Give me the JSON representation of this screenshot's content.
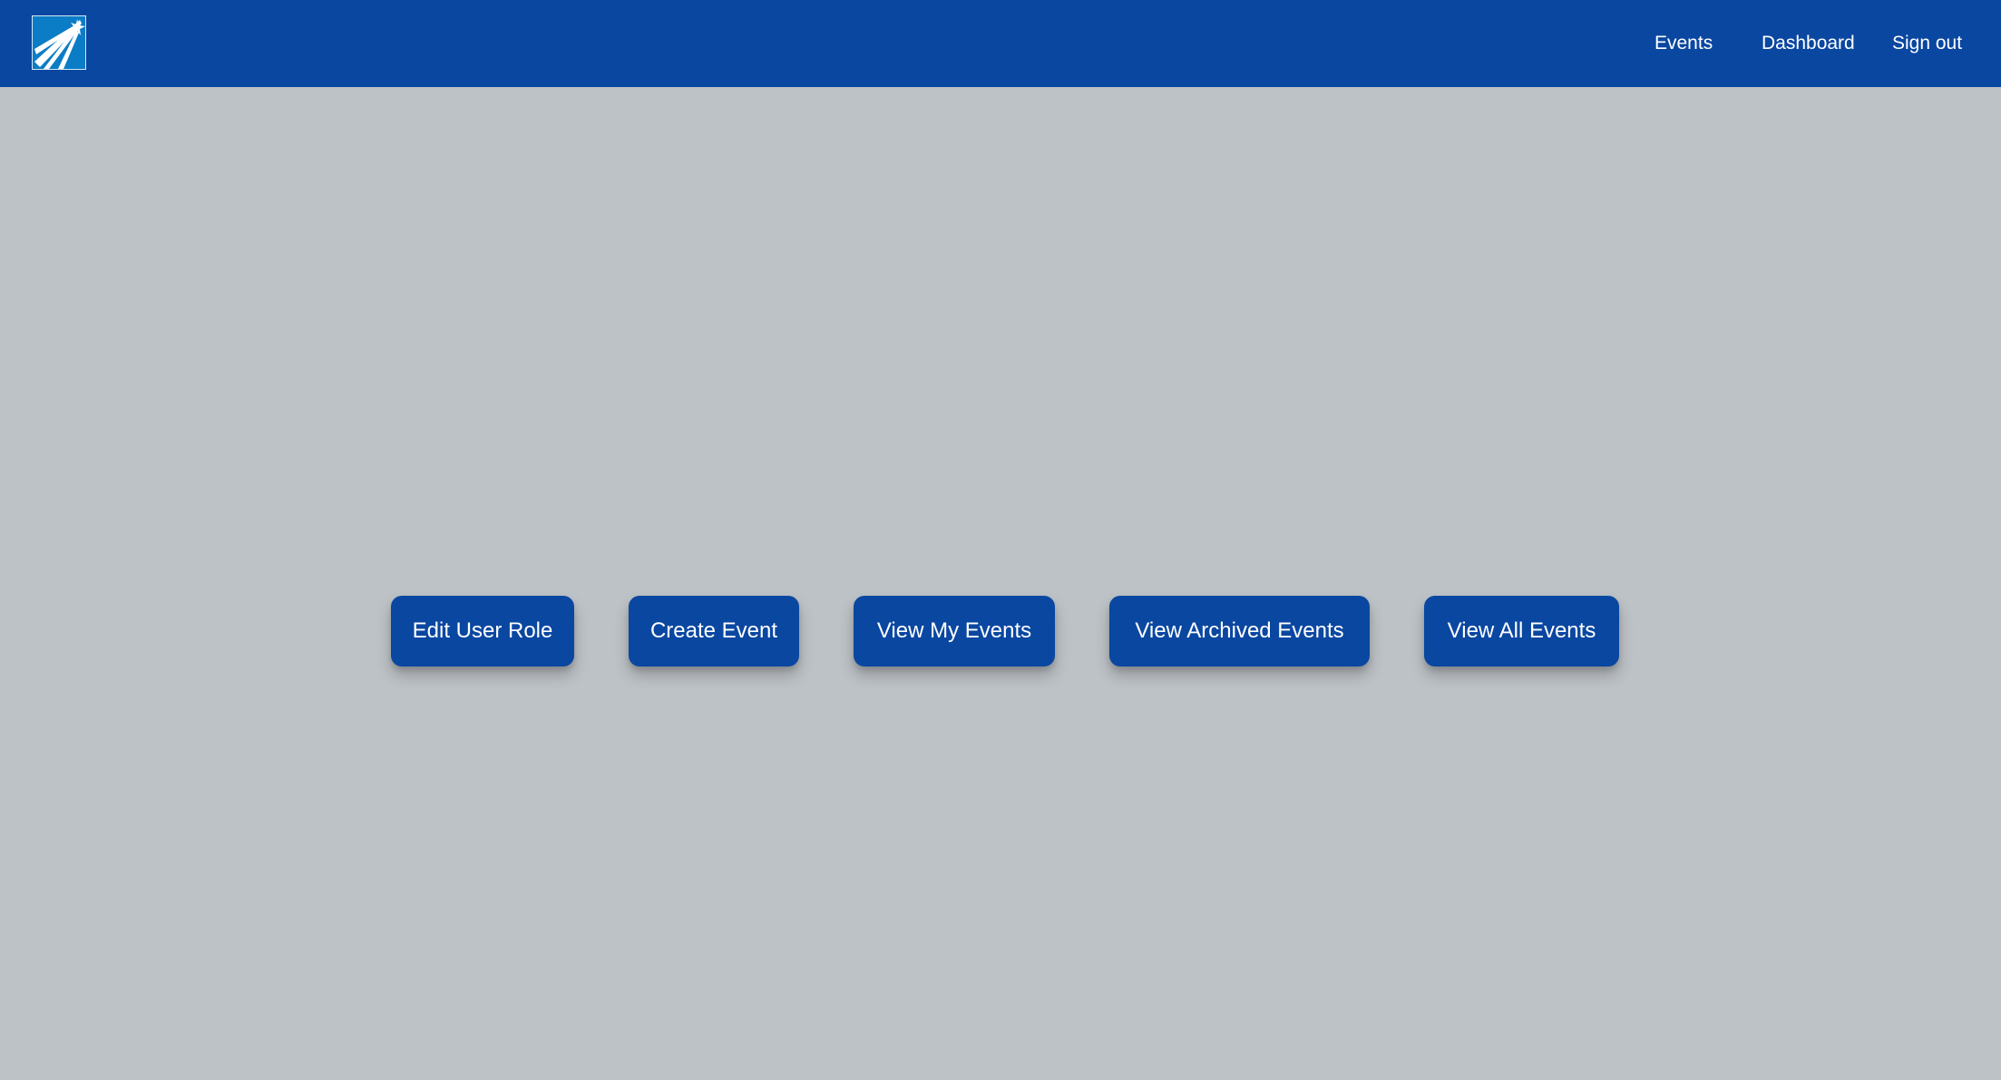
{
  "navbar": {
    "logo_icon": "shooting-star-logo-icon",
    "links": [
      {
        "label": "Events"
      },
      {
        "label": "Dashboard"
      },
      {
        "label": "Sign out"
      }
    ],
    "background_color": "#0a47a1"
  },
  "actions": [
    {
      "label": "Edit User Role"
    },
    {
      "label": "Create Event"
    },
    {
      "label": "View My Events"
    },
    {
      "label": "View Archived Events"
    },
    {
      "label": "View All Events"
    }
  ],
  "colors": {
    "page_background": "#bdc2c6",
    "button_background": "#0a47a1",
    "text": "#ffffff"
  }
}
